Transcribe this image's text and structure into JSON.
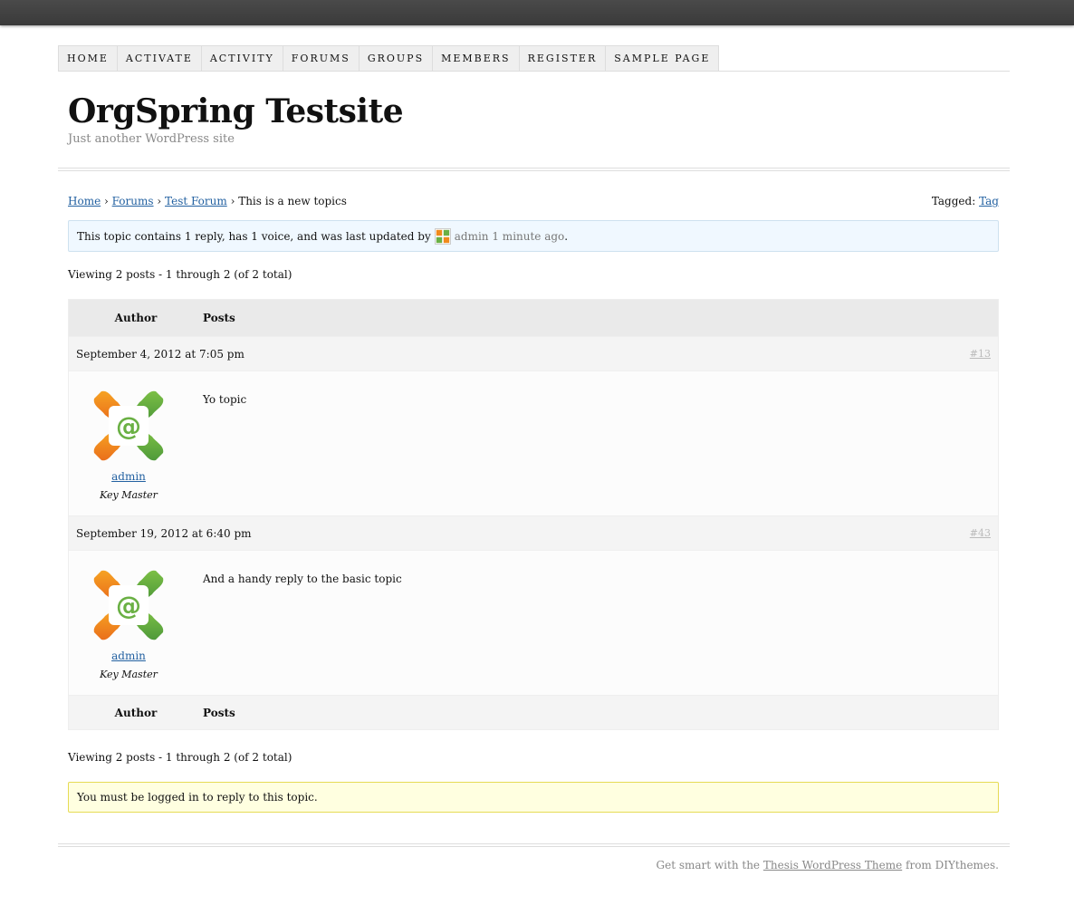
{
  "nav": {
    "items": [
      "Home",
      "Activate",
      "Activity",
      "Forums",
      "Groups",
      "Members",
      "Register",
      "Sample Page"
    ]
  },
  "site": {
    "title": "OrgSpring Testsite",
    "tagline": "Just another WordPress site"
  },
  "breadcrumb": {
    "home": "Home",
    "forums": "Forums",
    "test_forum": "Test Forum",
    "current": "This is a new topics",
    "separator": "›"
  },
  "tagged": {
    "label": "Tagged:",
    "tag": "Tag"
  },
  "topic_info": {
    "text": "This topic contains 1 reply, has 1 voice, and was last updated by",
    "user": "admin",
    "time": "1 minute ago",
    "suffix": "."
  },
  "pagination": {
    "viewing_text": "Viewing 2 posts - 1 through 2 (of 2 total)"
  },
  "table": {
    "header_author": "Author",
    "header_posts": "Posts",
    "footer_author": "Author",
    "footer_posts": "Posts"
  },
  "posts": [
    {
      "date": "September 4, 2012 at 7:05 pm",
      "permalink": "#13",
      "author": "admin",
      "role": "Key Master",
      "content": "Yo topic"
    },
    {
      "date": "September 19, 2012 at 6:40 pm",
      "permalink": "#43",
      "author": "admin",
      "role": "Key Master",
      "content": "And a handy reply to the basic topic"
    }
  ],
  "login_notice": "You must be logged in to reply to this topic.",
  "footer": {
    "prefix": "Get smart with the",
    "link": "Thesis WordPress Theme",
    "suffix": "from DIYthemes."
  },
  "colors": {
    "link": "#2361a1",
    "avatar_orange": "#f08a1c",
    "avatar_green": "#6ab044"
  }
}
